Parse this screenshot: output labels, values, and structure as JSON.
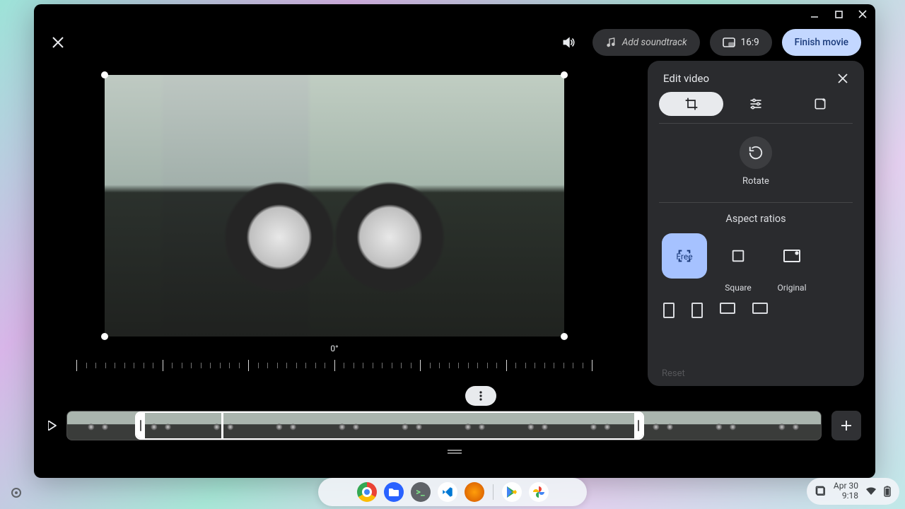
{
  "window": {
    "minimize": "—",
    "maximize": "☐",
    "close": "✕"
  },
  "toolbar": {
    "soundtrack_label": "Add soundtrack",
    "aspect_label": "16:9",
    "finish_label": "Finish movie"
  },
  "panel": {
    "title": "Edit video",
    "rotate_label": "Rotate",
    "aspect_title": "Aspect ratios",
    "ratios": {
      "free": "Free",
      "square": "Square",
      "original": "Original"
    },
    "reset_label": "Reset"
  },
  "editor": {
    "rotation_deg": "0°"
  },
  "systray": {
    "date": "Apr 30",
    "time": "9:18"
  }
}
